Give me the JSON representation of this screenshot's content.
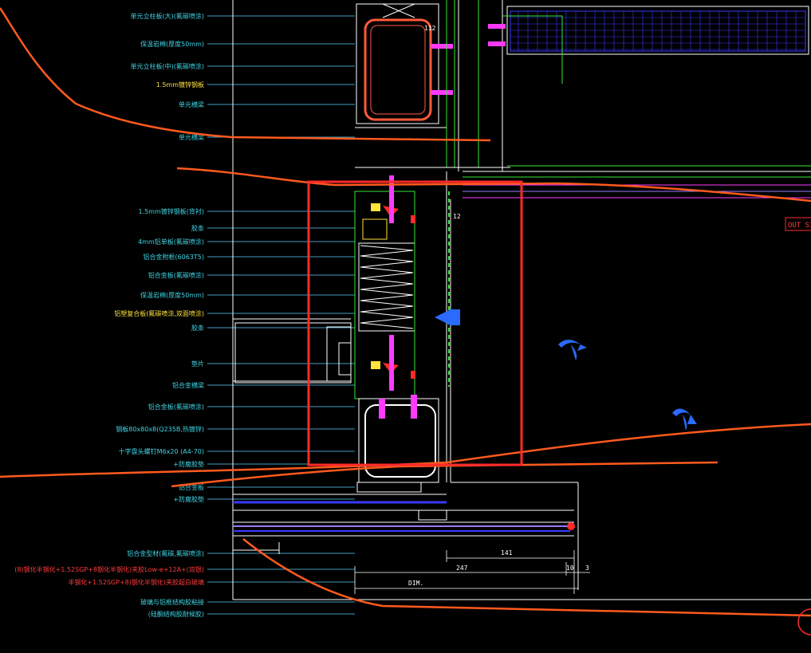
{
  "colors": {
    "background": "#000000",
    "label_cyan": "#3fd6e6",
    "label_yellow": "#ffe23a",
    "label_red": "#ff3a3a",
    "leader": "#5ad2ff",
    "mullion_red": "#ff5a3a",
    "orange_line": "#ff5a1e",
    "frame_white": "#ffffff",
    "green": "#38e838",
    "magenta": "#ff3aff",
    "blue_grid": "#3a3aff",
    "purple": "#9a7aff",
    "highlight_box": "#ff2a2a"
  },
  "labels": [
    {
      "text": "单元立柱板(大)(氟碳喷涂)",
      "color": "cyan"
    },
    {
      "text": "保温岩棉(厚度50mm)",
      "color": "cyan"
    },
    {
      "text": "单元立柱板(中)(氟碳喷涂)",
      "color": "cyan"
    },
    {
      "text": "1.5mm镀锌钢板",
      "color": "yellow"
    },
    {
      "text": "单元横梁",
      "color": "cyan"
    },
    {
      "text": "单元横梁",
      "color": "cyan"
    },
    {
      "text": "1.5mm镀锌钢板(背衬)",
      "color": "cyan"
    },
    {
      "text": "胶条",
      "color": "cyan"
    },
    {
      "text": "4mm铝单板(氟碳喷涂)",
      "color": "cyan"
    },
    {
      "text": "铝合金附框(6063T5)",
      "color": "cyan"
    },
    {
      "text": "铝合金板(氟碳喷涂)",
      "color": "cyan"
    },
    {
      "text": "保温岩棉(厚度50mm)",
      "color": "cyan"
    },
    {
      "text": "铝塑复合板(氟碳喷涂,双面喷涂)",
      "color": "yellow"
    },
    {
      "text": "胶条",
      "color": "cyan"
    },
    {
      "text": "垫片",
      "color": "cyan"
    },
    {
      "text": "铝合金横梁",
      "color": "cyan"
    },
    {
      "text": "铝合金板(氟碳喷涂)",
      "color": "cyan"
    },
    {
      "text": "钢板80x80x8(Q235B,热镀锌)",
      "color": "cyan"
    },
    {
      "text": "十字盘头螺钉M6x20 (A4-70)",
      "color": "cyan"
    },
    {
      "text": "+防腐胶垫",
      "color": "cyan"
    },
    {
      "text": "铝合金板",
      "color": "cyan"
    },
    {
      "text": "+防腐胶垫",
      "color": "cyan"
    },
    {
      "text": "铝合金型材(氟碳,氟碳喷涂)",
      "color": "cyan"
    },
    {
      "text": "(8)钢化半钢化+1.52SGP+8钢化半钢化)夹胶Low-e+12A+(双银)",
      "color": "red"
    },
    {
      "text": "半钢化+1.52SGP+8)钢化半钢化)夹胶超白玻璃",
      "color": "red"
    },
    {
      "text": "玻璃与铝框结构胶粘接",
      "color": "cyan"
    },
    {
      "text": "(硅酮结构胶耐候胶)",
      "color": "cyan"
    }
  ],
  "dimensions": [
    "112",
    "12",
    "141",
    "247",
    "10",
    "3",
    "DIM."
  ],
  "tag": "OUT SI"
}
